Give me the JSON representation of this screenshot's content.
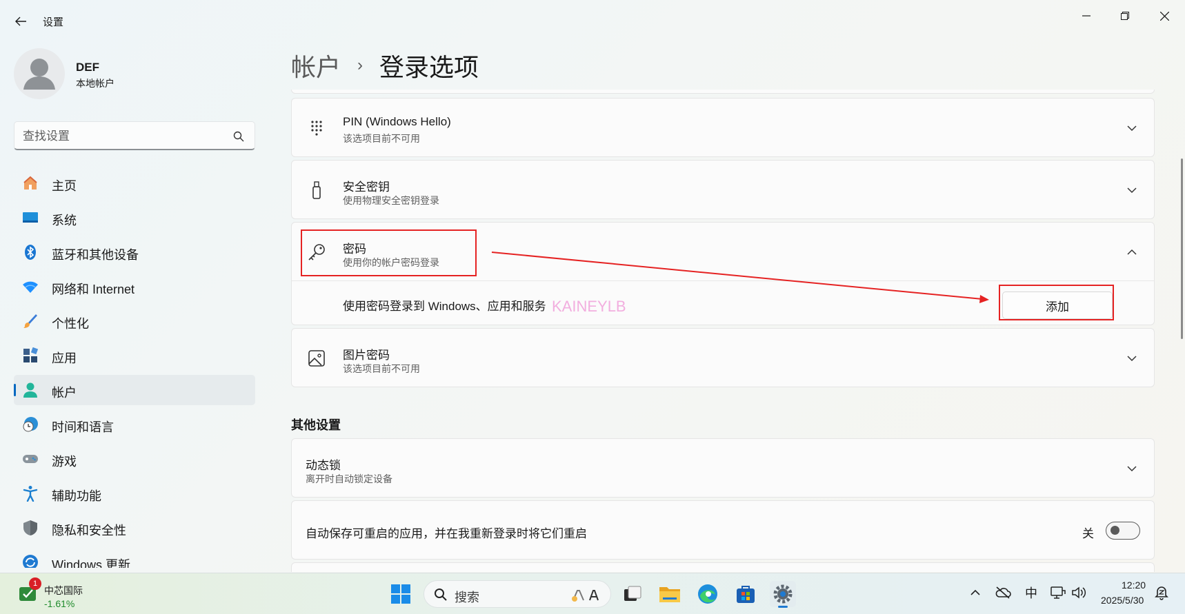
{
  "window": {
    "title": "设置",
    "back_icon": "arrow-left-icon",
    "controls": [
      "minimize-icon",
      "restore-icon",
      "close-icon"
    ]
  },
  "profile": {
    "name": "DEF",
    "account_type": "本地帐户"
  },
  "search": {
    "placeholder": "查找设置",
    "value": ""
  },
  "sidebar": {
    "items": [
      {
        "label": "主页",
        "icon": "home-icon"
      },
      {
        "label": "系统",
        "icon": "system-icon"
      },
      {
        "label": "蓝牙和其他设备",
        "icon": "bluetooth-icon"
      },
      {
        "label": "网络和 Internet",
        "icon": "wifi-icon"
      },
      {
        "label": "个性化",
        "icon": "brush-icon"
      },
      {
        "label": "应用",
        "icon": "apps-icon"
      },
      {
        "label": "帐户",
        "icon": "account-icon",
        "active": true
      },
      {
        "label": "时间和语言",
        "icon": "clock-globe-icon"
      },
      {
        "label": "游戏",
        "icon": "gamepad-icon"
      },
      {
        "label": "辅助功能",
        "icon": "accessibility-icon"
      },
      {
        "label": "隐私和安全性",
        "icon": "shield-icon"
      },
      {
        "label": "Windows 更新",
        "icon": "update-icon"
      }
    ]
  },
  "breadcrumb": {
    "parent": "帐户",
    "separator": "›",
    "current": "登录选项"
  },
  "sign_in_options": {
    "pin": {
      "title": "PIN (Windows Hello)",
      "subtitle": "该选项目前不可用",
      "icon": "keypad-icon",
      "expanded": false
    },
    "security_key": {
      "title": "安全密钥",
      "subtitle": "使用物理安全密钥登录",
      "icon": "usb-key-icon",
      "expanded": false
    },
    "password": {
      "title": "密码",
      "subtitle": "使用你的帐户密码登录",
      "icon": "key-icon",
      "expanded": true,
      "detail_text": "使用密码登录到 Windows、应用和服务",
      "add_button": "添加"
    },
    "picture_password": {
      "title": "图片密码",
      "subtitle": "该选项目前不可用",
      "icon": "picture-icon",
      "expanded": false
    }
  },
  "other_settings": {
    "header": "其他设置",
    "dynamic_lock": {
      "title": "动态锁",
      "subtitle": "离开时自动锁定设备"
    },
    "restart_apps": {
      "title": "自动保存可重启的应用，并在我重新登录时将它们重启",
      "state_label": "关",
      "on": false
    }
  },
  "watermark": "KAINEYLB",
  "annotation_color": "#e52222",
  "accent_color": "#0067c0",
  "taskbar": {
    "stock": {
      "name": "中芯国际",
      "change": "-1.61%",
      "badge": "1"
    },
    "search_label": "搜索",
    "apps": [
      "start-icon",
      "task-view-icon",
      "file-explorer-icon",
      "edge-icon",
      "store-icon",
      "settings-icon"
    ],
    "tray": {
      "ime": "中",
      "time": "12:20",
      "date": "2025/5/30"
    }
  }
}
